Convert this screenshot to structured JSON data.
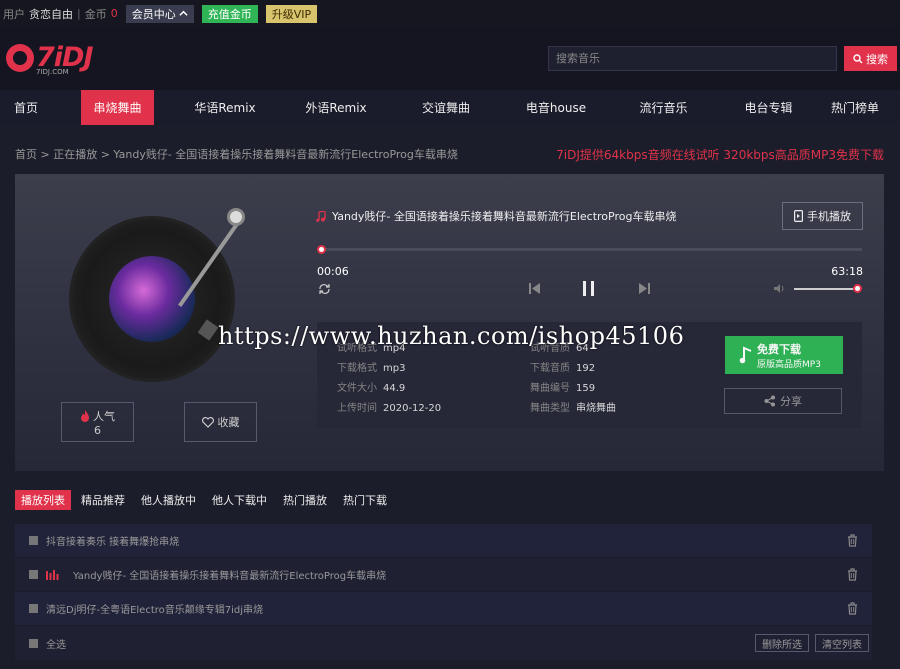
{
  "topbar": {
    "user_label": "用户",
    "username": "贪恋自由",
    "sep": "|",
    "coin_label": "金币",
    "coin_value": "0",
    "member_center": "会员中心",
    "recharge": "充值金币",
    "upgrade_vip": "升级VIP"
  },
  "header": {
    "logo_text": "7iDJ",
    "logo_sub": "7IDJ.COM",
    "search_placeholder": "搜索音乐",
    "search_button": "搜索"
  },
  "nav": {
    "items": [
      {
        "label": "首页"
      },
      {
        "label": "串烧舞曲",
        "active": true
      },
      {
        "label": "华语Remix"
      },
      {
        "label": "外语Remix"
      },
      {
        "label": "交谊舞曲"
      },
      {
        "label": "电音house"
      },
      {
        "label": "流行音乐"
      },
      {
        "label": "电台专辑"
      },
      {
        "label": "热门榜单"
      }
    ]
  },
  "breadcrumb": "首页 > 正在播放 > Yandy贱仔- 全国语接着操乐接着舞料音最新流行ElectroProg车载串烧",
  "promo": "7iDJ提供64kbps音频在线试听 320kbps高品质MP3免费下载",
  "player": {
    "song_title": "Yandy贱仔- 全国语接着操乐接着舞料音最新流行ElectroProg车载串烧",
    "mobile_play": "手机播放",
    "current_time": "00:06",
    "total_time": "63:18",
    "progress_fraction": 0.005,
    "volume_fraction": 1.0,
    "popularity_label": "人气",
    "popularity_value": "6",
    "favorite_label": "收藏",
    "info": {
      "listen_format_label": "试听格式",
      "listen_format": "mp4",
      "listen_quality_label": "试听音质",
      "listen_quality": "64",
      "download_format_label": "下载格式",
      "download_format": "mp3",
      "download_quality_label": "下载音质",
      "download_quality": "192",
      "file_size_label": "文件大小",
      "file_size": "44.9",
      "track_no_label": "舞曲编号",
      "track_no": "159",
      "upload_time_label": "上传时间",
      "upload_time": "2020-12-20",
      "genre_label": "舞曲类型",
      "genre": "串烧舞曲"
    },
    "download_label": "免费下载",
    "download_sub": "原版高品质MP3",
    "share_label": "分享"
  },
  "watermark": "https://www.huzhan.com/ishop45106",
  "tabs": [
    {
      "label": "播放列表",
      "active": true
    },
    {
      "label": "精品推荐"
    },
    {
      "label": "他人播放中"
    },
    {
      "label": "他人下载中"
    },
    {
      "label": "热门播放"
    },
    {
      "label": "热门下载"
    }
  ],
  "playlist": [
    {
      "title": "抖音接着奏乐 接着舞爆抢串烧",
      "playing": false
    },
    {
      "title": "Yandy贱仔- 全国语接着操乐接着舞料音最新流行ElectroProg车载串烧",
      "playing": true
    },
    {
      "title": "清远Dj明仔-全粤语Electro音乐颠缘专辑7idj串烧",
      "playing": false
    }
  ],
  "footer": {
    "select_all": "全选",
    "delete_selected": "删除所选",
    "clear_list": "清空列表"
  },
  "colors": {
    "accent": "#e0324a",
    "green": "#2fb556",
    "vip": "#d9c46e"
  }
}
